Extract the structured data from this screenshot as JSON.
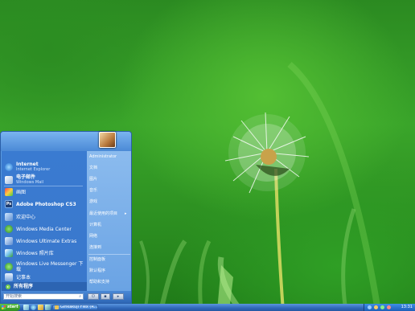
{
  "start_menu": {
    "pinned": [
      {
        "title": "Internet",
        "subtitle": "Internet Explorer",
        "icon": "internet-explorer-icon"
      },
      {
        "title": "电子邮件",
        "subtitle": "Windows Mail",
        "icon": "mail-icon"
      }
    ],
    "recent": [
      {
        "title": "画图",
        "icon": "paint-icon"
      },
      {
        "title": "Adobe Photoshop CS3",
        "icon": "photoshop-icon",
        "icon_text": "Ps"
      },
      {
        "title": "欢迎中心",
        "icon": "welcome-center-icon"
      },
      {
        "title": "Windows Media Center",
        "icon": "media-center-icon"
      },
      {
        "title": "Windows Ultimate Extras",
        "icon": "ultimate-extras-icon"
      },
      {
        "title": "Windows 照片库",
        "icon": "photo-gallery-icon"
      },
      {
        "title": "Windows Live Messenger 下载",
        "icon": "messenger-icon"
      },
      {
        "title": "记事本",
        "icon": "notepad-icon"
      }
    ],
    "all_programs": "所有程序",
    "right_items": [
      "Administrator",
      "文档",
      "图片",
      "音乐",
      "游戏",
      "最近使用的项目",
      "计算机",
      "网络",
      "连接到",
      "控制面板",
      "默认程序",
      "帮助和支持"
    ],
    "search_placeholder": "开始搜索"
  },
  "taskbar": {
    "start_label": "start",
    "task_label": "Ginkakuji Flex (R...",
    "clock": "13:31"
  }
}
